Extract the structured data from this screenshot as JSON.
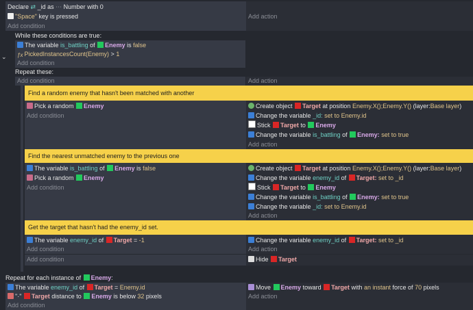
{
  "colors": {
    "background": "#25282f",
    "condition_bg": "#363a45",
    "action_bg": "#2b2e36",
    "comment_bg": "#f6d14a",
    "enemy": "#22c95d",
    "target": "#d92626"
  },
  "e1": {
    "declare": "Declare",
    "varname": "_id",
    "as": "as",
    "type": "Number",
    "with": "with",
    "value": "0",
    "key_str": "\"Space\"",
    "key_rest": "key is pressed",
    "add_condition": "Add condition",
    "add_action": "Add action"
  },
  "e2": {
    "header": "While these conditions are true:",
    "c1_pre": "The variable",
    "c1_var": "is_battling",
    "c1_of": "of",
    "c1_obj": "Enemy",
    "c1_is": "is",
    "c1_val": "false",
    "c2_expr": "PickedInstancesCount(Enemy)",
    "c2_op": ">",
    "c2_val": "1",
    "add_condition": "Add condition",
    "repeat": "Repeat these:",
    "sub_add_condition": "Add condition",
    "sub_add_action": "Add action"
  },
  "comment1": "Find a random enemy that hasn't been matched with another",
  "b1": {
    "cond_pre": "Pick a random",
    "cond_obj": "Enemy",
    "add_condition": "Add condition",
    "a1_pre": "Create object",
    "a1_obj": "Target",
    "a1_mid": "at position",
    "a1_pos": "Enemy.X();Enemy.Y()",
    "a1_layer": "(layer:",
    "a1_layername": "Base layer",
    "a1_end": ")",
    "a2_pre": "Change the variable",
    "a2_var": "_id:",
    "a2_set": "set to",
    "a2_val": "Enemy.id",
    "a3_pre": "Stick",
    "a3_obj": "Target",
    "a3_to": "to",
    "a3_obj2": "Enemy",
    "a4_pre": "Change the variable",
    "a4_var": "is_battling",
    "a4_of": "of",
    "a4_obj": "Enemy:",
    "a4_set": "set to true",
    "add_action": "Add action"
  },
  "comment2": "Find the nearest unmatched enemy to the previous one",
  "b2": {
    "c1_pre": "The variable",
    "c1_var": "is_battling",
    "c1_of": "of",
    "c1_obj": "Enemy",
    "c1_is": "is",
    "c1_val": "false",
    "c2_pre": "Pick a random",
    "c2_obj": "Enemy",
    "add_condition": "Add condition",
    "a1_pre": "Create object",
    "a1_obj": "Target",
    "a1_mid": "at position",
    "a1_pos": "Enemy.X();Enemy.Y()",
    "a1_layer": "(layer:",
    "a1_layername": "Base layer",
    "a1_end": ")",
    "a2_pre": "Change the variable",
    "a2_var": "enemy_id",
    "a2_of": "of",
    "a2_obj": "Target:",
    "a2_set": "set to",
    "a2_val": "_id",
    "a3_pre": "Stick",
    "a3_obj": "Target",
    "a3_to": "to",
    "a3_obj2": "Enemy",
    "a4_pre": "Change the variable",
    "a4_var": "is_battling",
    "a4_of": "of",
    "a4_obj": "Enemy:",
    "a4_set": "set to true",
    "a5_pre": "Change the variable",
    "a5_var": "_id:",
    "a5_set": "set to",
    "a5_val": "Enemy.id",
    "add_action": "Add action"
  },
  "comment3": "Get the target that hasn't had the enemy_id set.",
  "b3": {
    "c1_pre": "The variable",
    "c1_var": "enemy_id",
    "c1_of": "of",
    "c1_obj": "Target",
    "c1_op": "=",
    "c1_val": "-1",
    "add_condition": "Add condition",
    "a1_pre": "Change the variable",
    "a1_var": "enemy_id",
    "a1_of": "of",
    "a1_obj": "Target:",
    "a1_set": "set to",
    "a1_val": "_id",
    "add_action": "Add action"
  },
  "b4": {
    "add_condition": "Add condition",
    "a1_pre": "Hide",
    "a1_obj": "Target"
  },
  "e3": {
    "header_pre": "Repeat for each instance of",
    "header_obj": "Enemy",
    "header_end": ":",
    "c1_pre": "The variable",
    "c1_var": "enemy_id",
    "c1_of": "of",
    "c1_obj": "Target",
    "c1_op": "=",
    "c1_val": "Enemy.id",
    "c2_pre": "\"·\"",
    "c2_obj": "Target",
    "c2_mid": "distance to",
    "c2_obj2": "Enemy",
    "c2_is": "is below",
    "c2_val": "32",
    "c2_unit": "pixels",
    "add_condition": "Add condition",
    "a1_pre": "Move",
    "a1_obj": "Enemy",
    "a1_mid": "toward",
    "a1_obj2": "Target",
    "a1_with": "with",
    "a1_force": "an instant",
    "a1_force2": "force of",
    "a1_val": "70",
    "a1_unit": "pixels",
    "add_action": "Add action"
  }
}
